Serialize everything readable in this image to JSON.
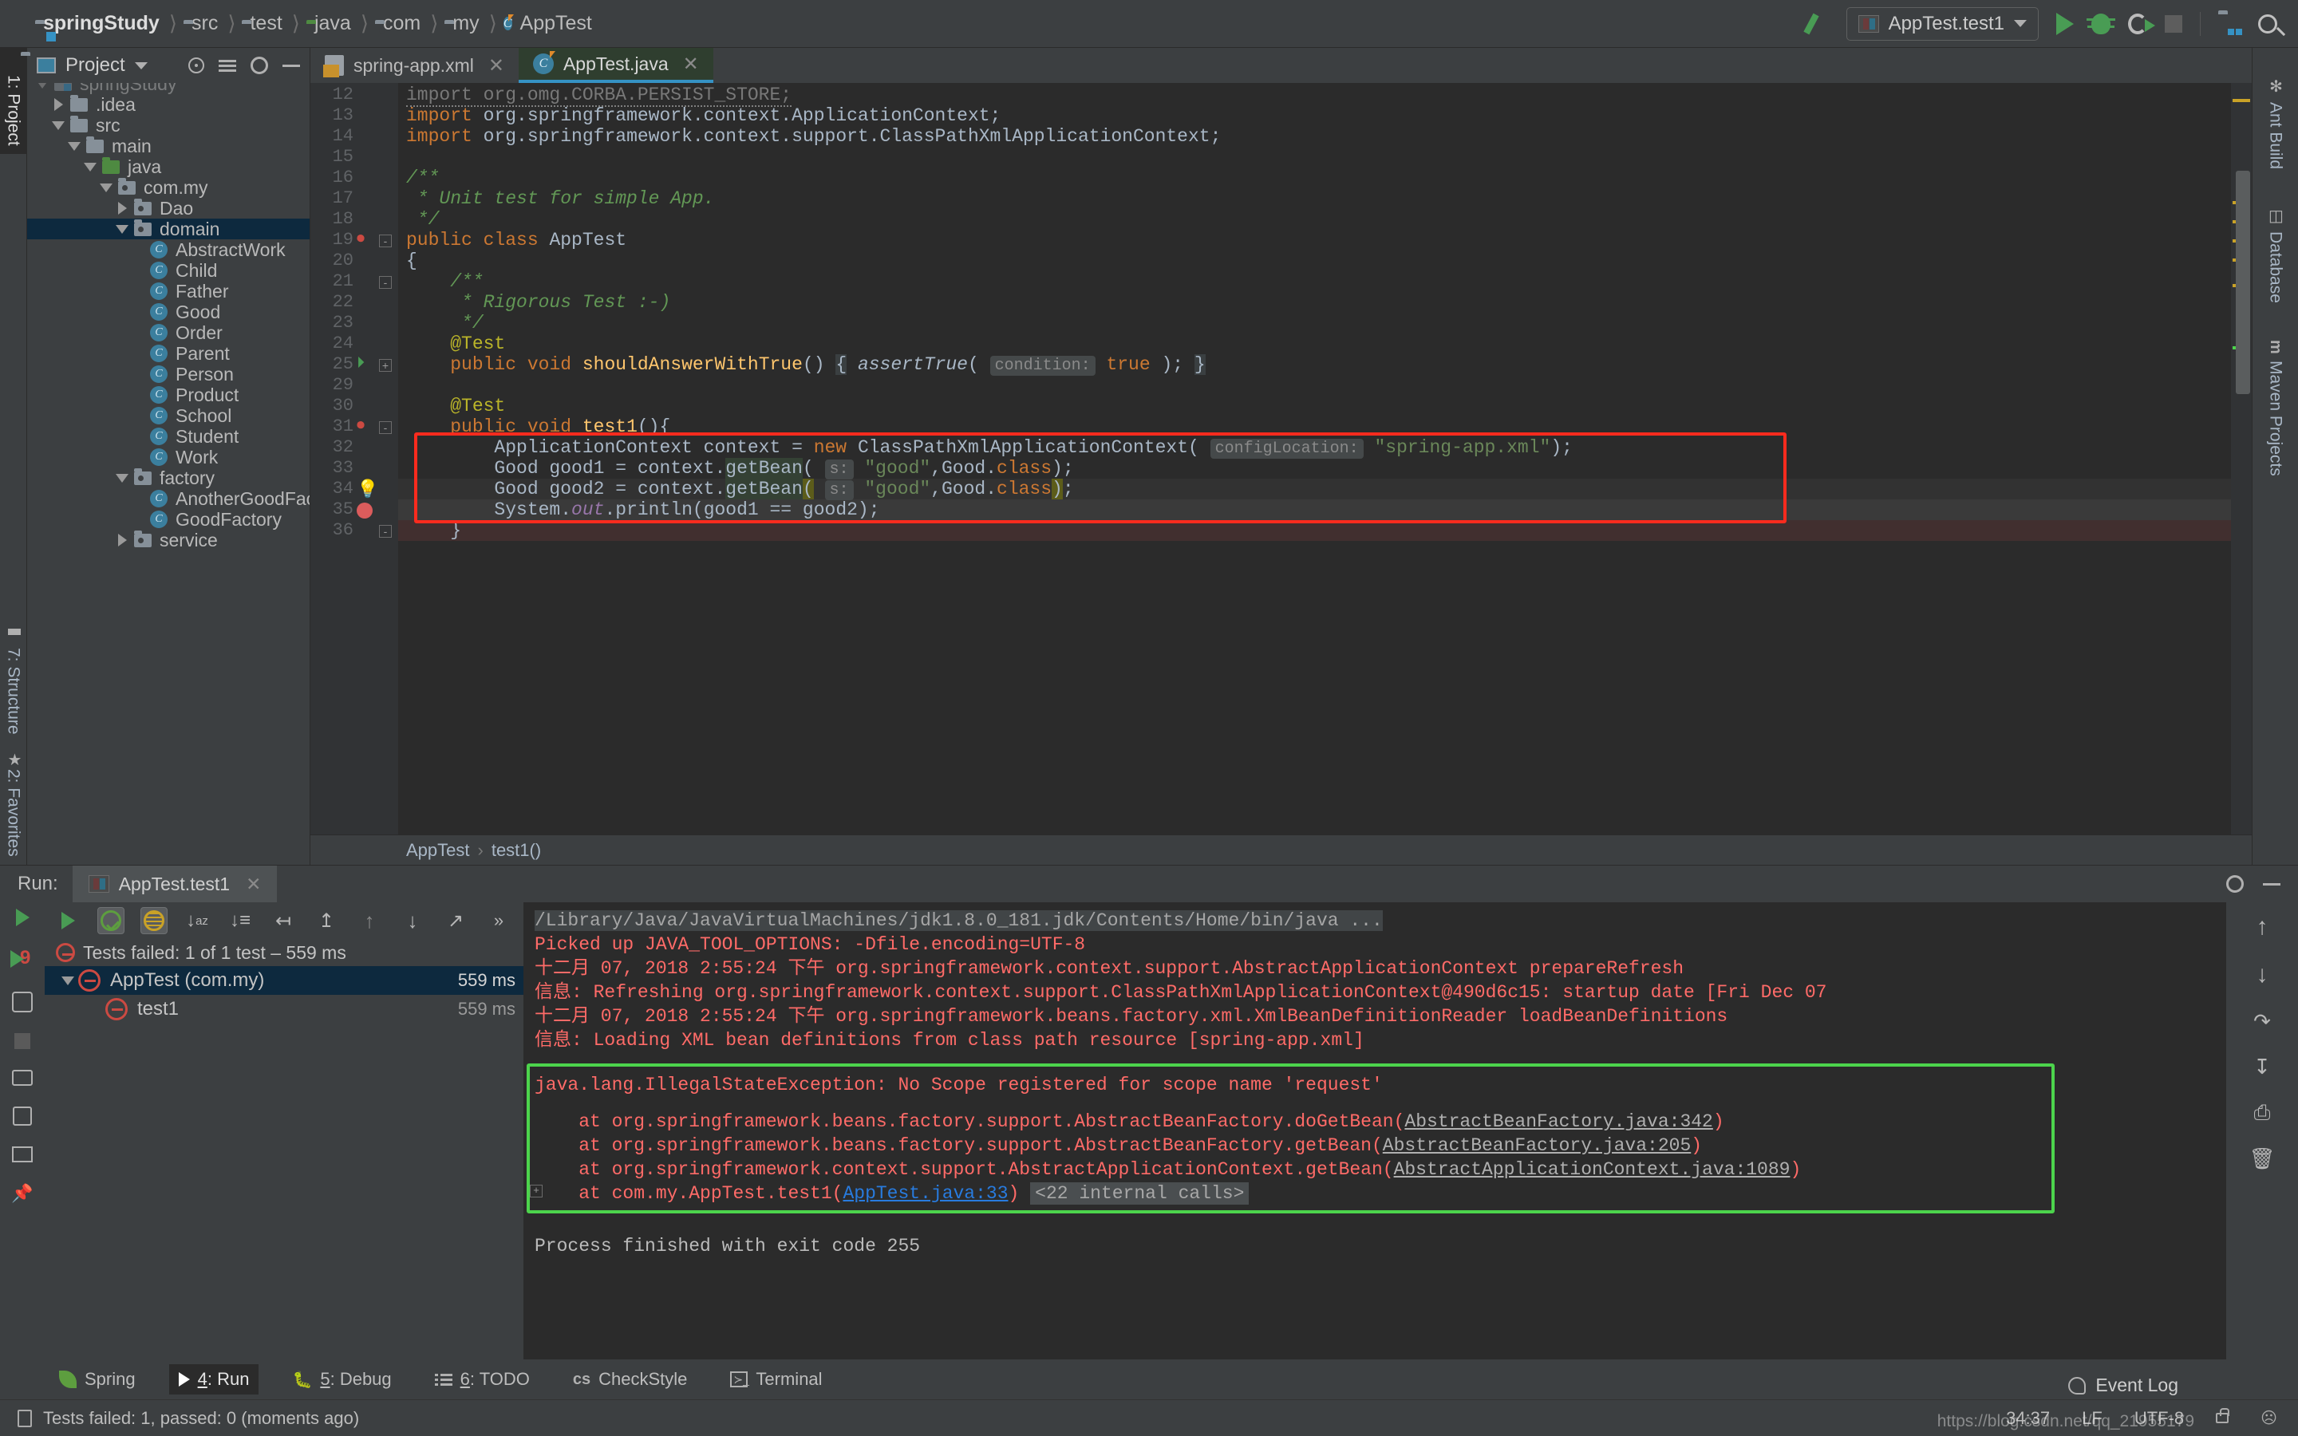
{
  "toolbar": {
    "breadcrumbs": [
      {
        "label": "springStudy",
        "icon": "module-folder-icon"
      },
      {
        "label": "src",
        "icon": "folder-icon"
      },
      {
        "label": "test",
        "icon": "folder-icon"
      },
      {
        "label": "java",
        "icon": "source-folder-icon"
      },
      {
        "label": "com",
        "icon": "package-icon"
      },
      {
        "label": "my",
        "icon": "package-icon"
      },
      {
        "label": "AppTest",
        "icon": "java-class-icon"
      }
    ],
    "run_config": "AppTest.test1",
    "buttons": [
      "hammer-build-icon",
      "run-icon",
      "debug-icon",
      "run-with-coverage-icon",
      "stop-icon",
      "project-structure-icon",
      "search-everywhere-icon"
    ]
  },
  "left_rail": {
    "top": [
      {
        "label": "1: Project",
        "num": "1",
        "selected": true
      }
    ],
    "bottom": [
      {
        "label": "7: Structure",
        "num": "7"
      },
      {
        "label": "2: Favorites",
        "num": "2"
      }
    ]
  },
  "right_rail": [
    {
      "label": "Ant Build",
      "icon": "ant-icon"
    },
    {
      "label": "Database",
      "icon": "database-icon"
    },
    {
      "label": "Maven Projects",
      "icon": "maven-icon"
    }
  ],
  "project_panel": {
    "title": "Project",
    "tree": [
      {
        "label": "springStudy",
        "depth": 0,
        "arrow": "down",
        "icon": "module-folder-icon",
        "cut": true
      },
      {
        "label": ".idea",
        "depth": 1,
        "arrow": "right",
        "icon": "folder-icon"
      },
      {
        "label": "src",
        "depth": 1,
        "arrow": "down",
        "icon": "folder-icon"
      },
      {
        "label": "main",
        "depth": 2,
        "arrow": "down",
        "icon": "folder-icon"
      },
      {
        "label": "java",
        "depth": 3,
        "arrow": "down",
        "icon": "source-folder-icon"
      },
      {
        "label": "com.my",
        "depth": 4,
        "arrow": "down",
        "icon": "package-icon"
      },
      {
        "label": "Dao",
        "depth": 5,
        "arrow": "right",
        "icon": "package-icon"
      },
      {
        "label": "domain",
        "depth": 5,
        "arrow": "down",
        "icon": "package-icon",
        "selected": true
      },
      {
        "label": "AbstractWork",
        "depth": 6,
        "arrow": "none",
        "icon": "java-class-icon"
      },
      {
        "label": "Child",
        "depth": 6,
        "arrow": "none",
        "icon": "java-class-icon"
      },
      {
        "label": "Father",
        "depth": 6,
        "arrow": "none",
        "icon": "java-class-icon"
      },
      {
        "label": "Good",
        "depth": 6,
        "arrow": "none",
        "icon": "java-class-icon"
      },
      {
        "label": "Order",
        "depth": 6,
        "arrow": "none",
        "icon": "java-class-icon"
      },
      {
        "label": "Parent",
        "depth": 6,
        "arrow": "none",
        "icon": "java-class-icon"
      },
      {
        "label": "Person",
        "depth": 6,
        "arrow": "none",
        "icon": "java-class-icon"
      },
      {
        "label": "Product",
        "depth": 6,
        "arrow": "none",
        "icon": "java-class-icon"
      },
      {
        "label": "School",
        "depth": 6,
        "arrow": "none",
        "icon": "java-class-icon"
      },
      {
        "label": "Student",
        "depth": 6,
        "arrow": "none",
        "icon": "java-class-icon"
      },
      {
        "label": "Work",
        "depth": 6,
        "arrow": "none",
        "icon": "java-class-icon"
      },
      {
        "label": "factory",
        "depth": 5,
        "arrow": "down",
        "icon": "package-icon"
      },
      {
        "label": "AnotherGoodFactory",
        "depth": 6,
        "arrow": "none",
        "icon": "java-class-icon"
      },
      {
        "label": "GoodFactory",
        "depth": 6,
        "arrow": "none",
        "icon": "java-class-icon"
      },
      {
        "label": "service",
        "depth": 5,
        "arrow": "right",
        "icon": "package-icon"
      }
    ]
  },
  "editor": {
    "tabs": [
      {
        "label": "spring-app.xml",
        "icon": "xml-spring-icon",
        "active": false
      },
      {
        "label": "AppTest.java",
        "icon": "java-class-icon",
        "active": true
      }
    ],
    "line_numbers": [
      "12",
      "13",
      "14",
      "15",
      "16",
      "17",
      "18",
      "19",
      "20",
      "21",
      "22",
      "23",
      "24",
      "25",
      "29",
      "30",
      "31",
      "32",
      "33",
      "34",
      "35",
      "36"
    ],
    "code_lines": [
      "import org.omg.CORBA.PERSIST_STORE;",
      "import org.springframework.context.ApplicationContext;",
      "import org.springframework.context.support.ClassPathXmlApplicationContext;",
      "",
      "/**",
      " * Unit test for simple App.",
      " */",
      "public class AppTest",
      "{",
      "    /**",
      "     * Rigorous Test :-)",
      "     */",
      "    @Test",
      "    public void shouldAnswerWithTrue() { assertTrue( condition: true ); }",
      "",
      "    @Test",
      "    public void test1(){",
      "        ApplicationContext context = new ClassPathXmlApplicationContext( configLocation: \"spring-app.xml\");",
      "        Good good1 = context.getBean( s: \"good\",Good.class);",
      "        Good good2 = context.getBean( s: \"good\",Good.class);",
      "        System.out.println(good1 == good2);",
      "    }"
    ],
    "breadcrumb": [
      "AppTest",
      "test1()"
    ]
  },
  "run_panel": {
    "label": "Run:",
    "tab": "AppTest.test1",
    "status": "Tests failed: 1 of 1 test – 559 ms",
    "tree": [
      {
        "label": "AppTest (com.my)",
        "time": "559 ms",
        "depth": 0,
        "selected": true,
        "arrow": "down"
      },
      {
        "label": "test1",
        "time": "559 ms",
        "depth": 1,
        "selected": false,
        "arrow": "none"
      }
    ],
    "console": {
      "cmd": "/Library/Java/JavaVirtualMachines/jdk1.8.0_181.jdk/Contents/Home/bin/java ...",
      "lines": [
        "Picked up JAVA_TOOL_OPTIONS: -Dfile.encoding=UTF-8",
        "十二月 07, 2018 2:55:24 下午 org.springframework.context.support.AbstractApplicationContext prepareRefresh",
        "信息: Refreshing org.springframework.context.support.ClassPathXmlApplicationContext@490d6c15: startup date [Fri Dec 07",
        "十二月 07, 2018 2:55:24 下午 org.springframework.beans.factory.xml.XmlBeanDefinitionReader loadBeanDefinitions",
        "信息: Loading XML bean definitions from class path resource [spring-app.xml]"
      ],
      "exception_header": "java.lang.IllegalStateException: No Scope registered for scope name 'request'",
      "stack": [
        {
          "prefix": "    at org.springframework.beans.factory.support.AbstractBeanFactory.doGetBean(",
          "link": "AbstractBeanFactory.java:342",
          "suffix": ")"
        },
        {
          "prefix": "    at org.springframework.beans.factory.support.AbstractBeanFactory.getBean(",
          "link": "AbstractBeanFactory.java:205",
          "suffix": ")"
        },
        {
          "prefix": "    at org.springframework.context.support.AbstractApplicationContext.getBean(",
          "link": "AbstractApplicationContext.java:1089",
          "suffix": ")"
        },
        {
          "prefix": "    at com.my.AppTest.test1(",
          "link": "AppTest.java:33",
          "suffix": ")",
          "chip": "<22 internal calls>"
        }
      ],
      "exit": "Process finished with exit code 255"
    },
    "side_icons": [
      "up-arrow-icon",
      "down-arrow-icon",
      "soft-wrap-icon",
      "scroll-to-end-icon",
      "print-icon",
      "trash-icon"
    ]
  },
  "bottom_tools": [
    {
      "label": "Spring",
      "num": "",
      "icon": "spring-icon",
      "selected": false
    },
    {
      "label": "4: Run",
      "num": "4",
      "icon": "run-icon",
      "selected": true
    },
    {
      "label": "5: Debug",
      "num": "5",
      "icon": "debug-icon",
      "selected": false
    },
    {
      "label": "6: TODO",
      "num": "6",
      "icon": "todo-icon",
      "selected": false
    },
    {
      "label": "CheckStyle",
      "num": "",
      "icon": "checkstyle-icon",
      "selected": false
    },
    {
      "label": "Terminal",
      "num": "",
      "icon": "terminal-icon",
      "selected": false
    }
  ],
  "status_bar": {
    "message": "Tests failed: 1, passed: 0 (moments ago)",
    "event_log": "Event Log",
    "caret": "34:37",
    "line_sep": "LF",
    "encoding": "UTF-8",
    "watermark": "https://blog.csdn.net/qq_21955179"
  },
  "colors": {
    "accent": "#3592c4",
    "error": "#ff6b68",
    "red_box": "#fb2b1e",
    "green_box": "#4cd44c",
    "selection": "#0d293e"
  }
}
